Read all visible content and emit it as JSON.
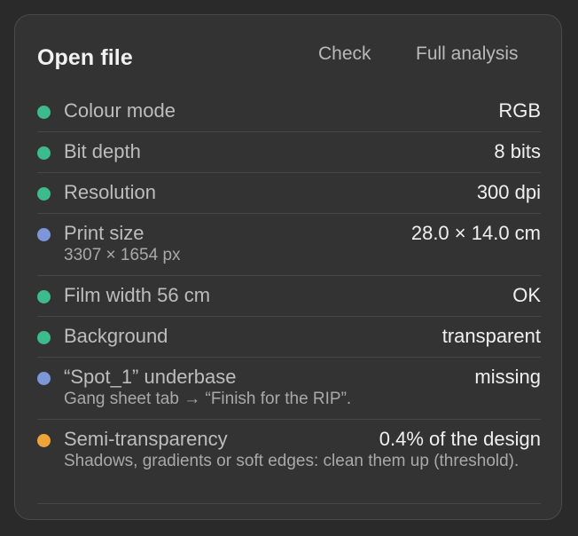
{
  "header": {
    "title": "Open file",
    "check_label": "Check",
    "full_analysis_label": "Full analysis"
  },
  "colors": {
    "ok": "#3dbb8d",
    "info": "#7d96d8",
    "warn": "#efa43a"
  },
  "rows": [
    {
      "status": "ok",
      "label": "Colour mode",
      "value": "RGB"
    },
    {
      "status": "ok",
      "label": "Bit depth",
      "value": "8 bits"
    },
    {
      "status": "ok",
      "label": "Resolution",
      "value": "300 dpi"
    },
    {
      "status": "info",
      "label": "Print size",
      "value": "28.0 × 14.0 cm",
      "sub": "3307 × 1654 px"
    },
    {
      "status": "ok",
      "label": "Film width 56 cm",
      "value": "OK"
    },
    {
      "status": "ok",
      "label": "Background",
      "value": "transparent"
    },
    {
      "status": "info",
      "label": "“Spot_1” underbase",
      "value": "missing",
      "sub": "Gang sheet tab → “Finish for the RIP”."
    },
    {
      "status": "warn",
      "label": "Semi-transparency",
      "value": "0.4% of the design",
      "sub": "Shadows, gradients or soft edges: clean them up (threshold)."
    }
  ]
}
